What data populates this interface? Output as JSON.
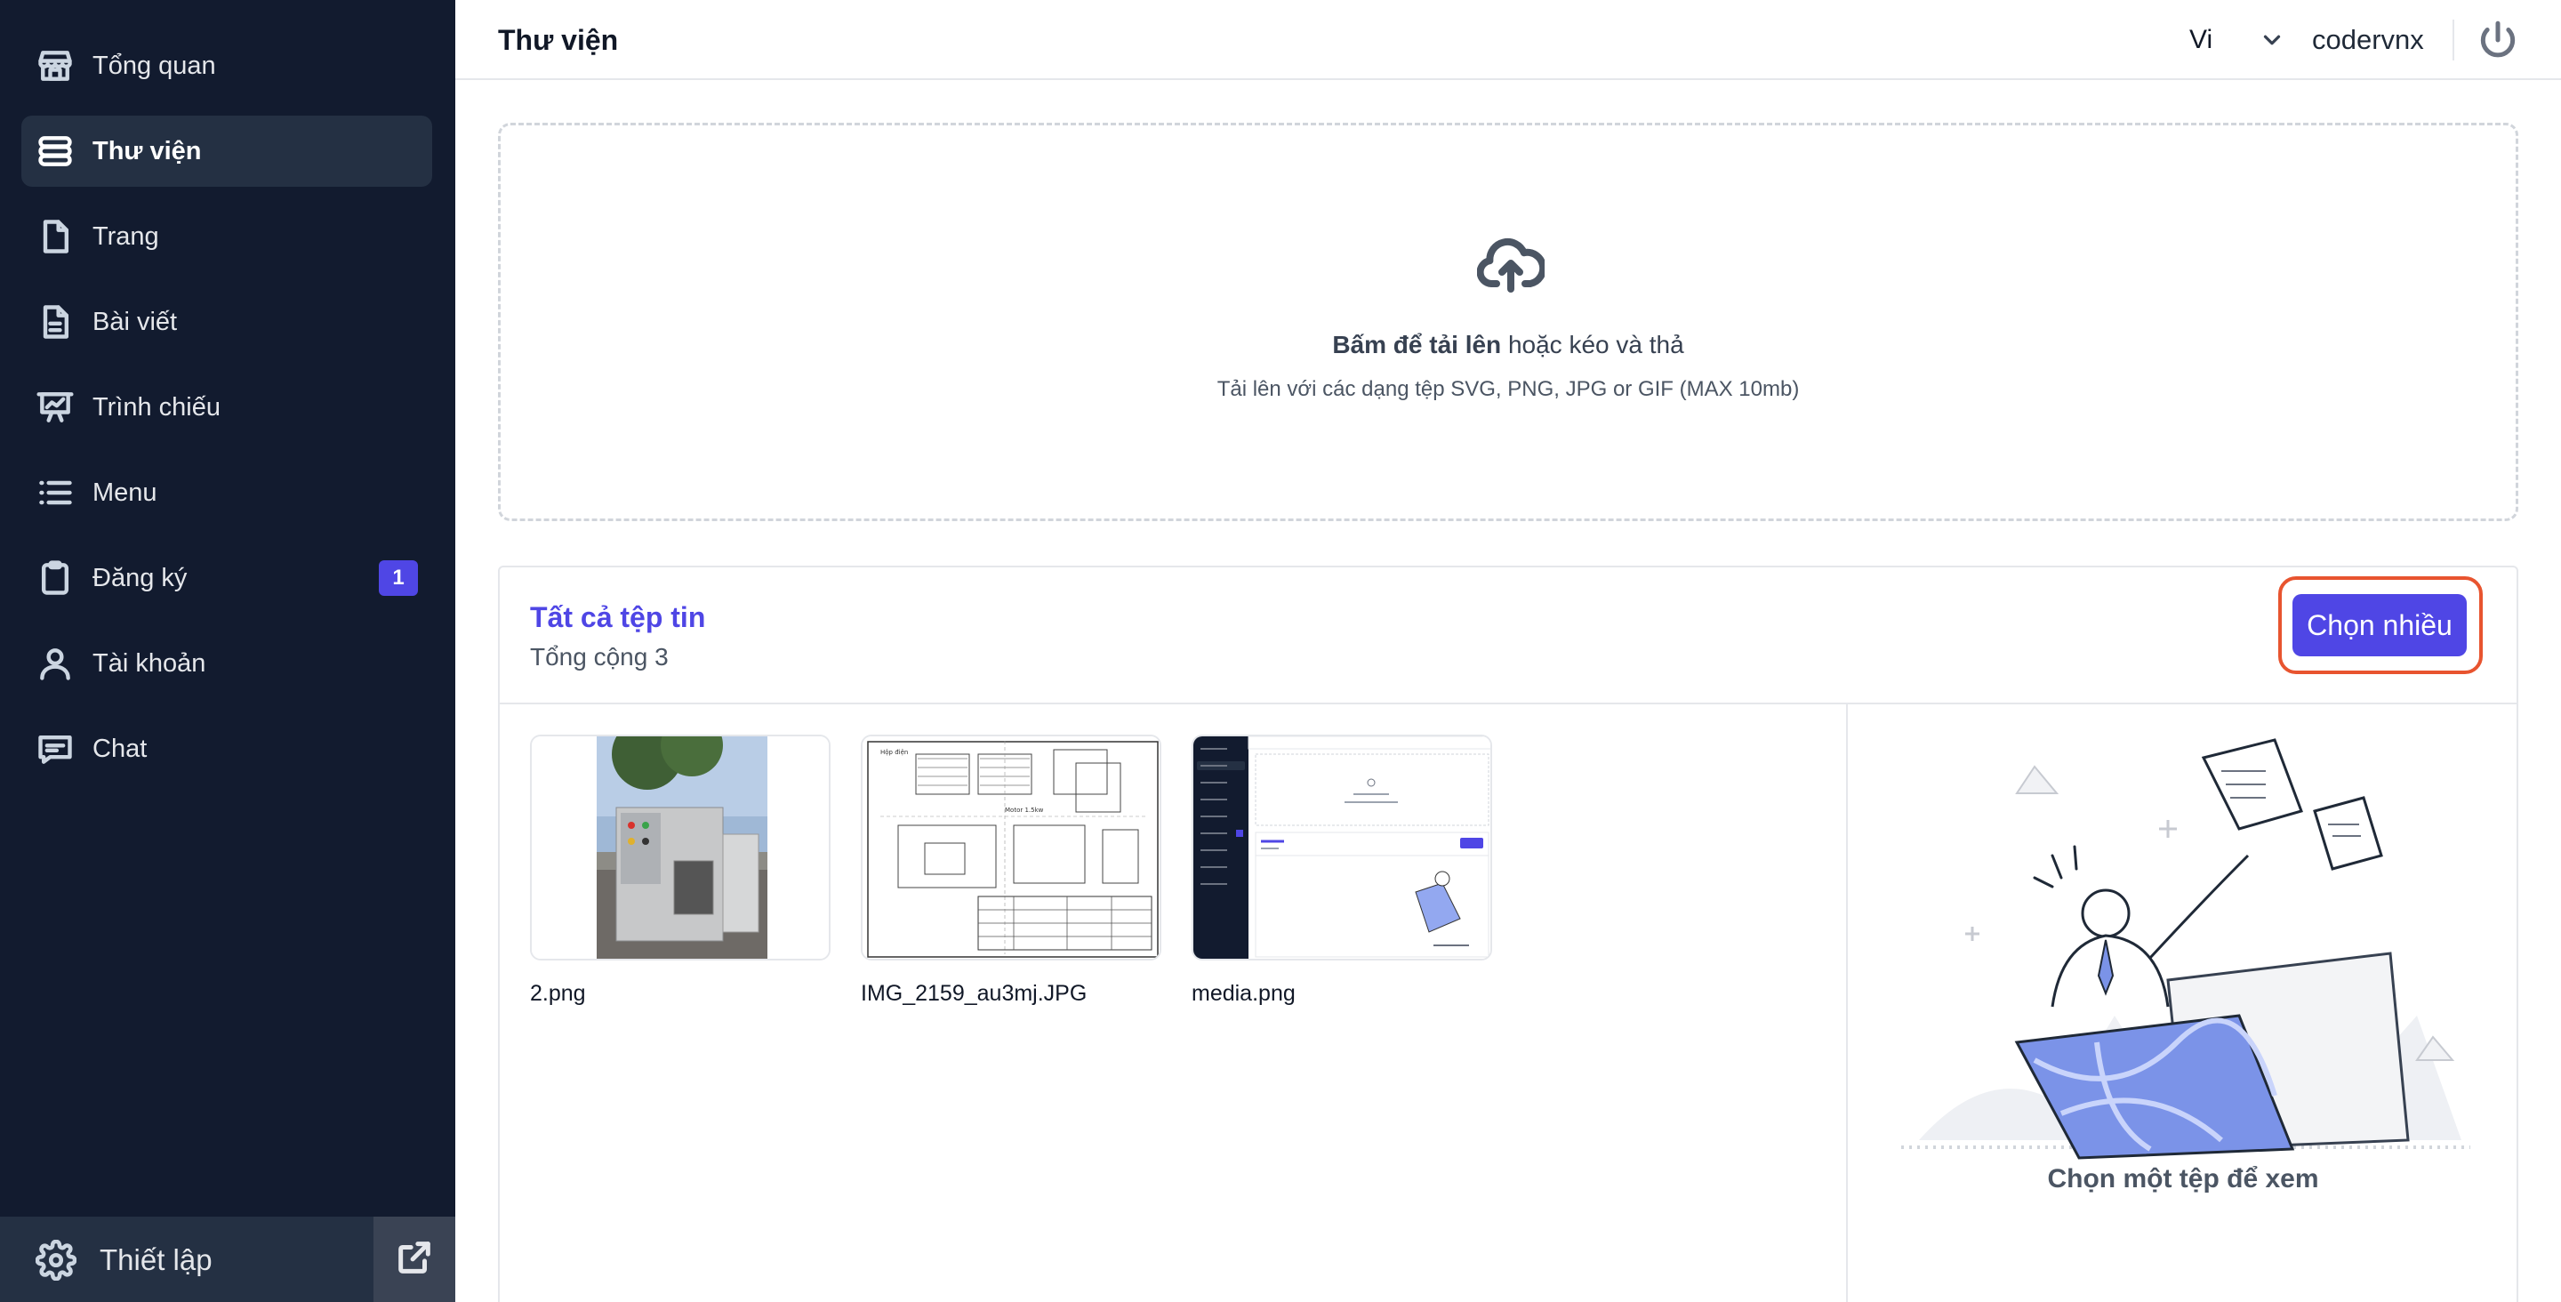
{
  "sidebar": {
    "items": [
      {
        "label": "Tổng quan",
        "icon": "storefront-icon"
      },
      {
        "label": "Thư viện",
        "icon": "stack-icon"
      },
      {
        "label": "Trang",
        "icon": "page-icon"
      },
      {
        "label": "Bài viết",
        "icon": "document-icon"
      },
      {
        "label": "Trình chiếu",
        "icon": "presentation-icon"
      },
      {
        "label": "Menu",
        "icon": "list-icon"
      },
      {
        "label": "Đăng ký",
        "icon": "clipboard-icon",
        "badge": "1"
      },
      {
        "label": "Tài khoản",
        "icon": "user-icon"
      },
      {
        "label": "Chat",
        "icon": "chat-icon"
      }
    ],
    "active_index": 1,
    "settings_label": "Thiết lập"
  },
  "topbar": {
    "title": "Thư viện",
    "language": "Vi",
    "username": "codervnx"
  },
  "upload": {
    "title_bold": "Bấm để tải lên",
    "title_rest": " hoặc kéo và thả",
    "hint": "Tải lên với các dạng tệp SVG, PNG, JPG or GIF (MAX 10mb)"
  },
  "files": {
    "title": "Tất cả tệp tin",
    "total": "Tổng cộng 3",
    "select_multiple": "Chọn nhiều",
    "items": [
      {
        "name": "2.png"
      },
      {
        "name": "IMG_2159_au3mj.JPG"
      },
      {
        "name": "media.png"
      }
    ],
    "preview_placeholder": "Chọn một tệp để xem"
  },
  "colors": {
    "sidebar_bg": "#121b2f",
    "accent": "#4f46e5",
    "highlight": "#e8542f"
  }
}
